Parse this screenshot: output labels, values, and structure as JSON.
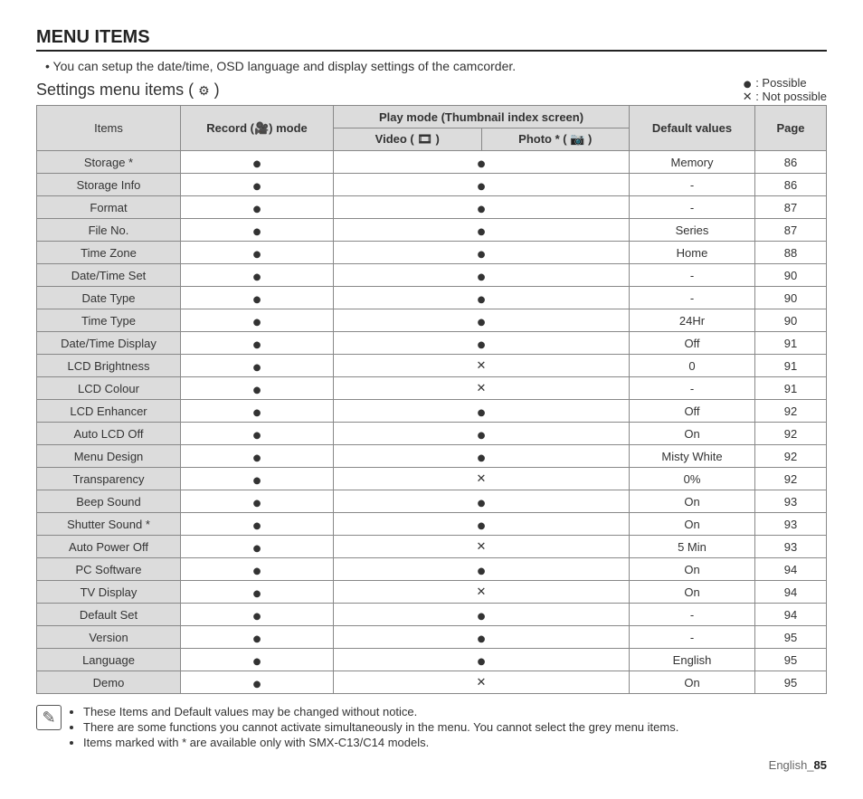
{
  "title": "MENU ITEMS",
  "intro_bullet": "•",
  "intro_text": "You can setup the date/time, OSD language and display settings of the camcorder.",
  "subtitle_prefix": "Settings menu items ( ",
  "subtitle_suffix": " )",
  "legend": {
    "possible_symbol": "●",
    "possible_text": " : Possible",
    "notpossible_symbol": "✕",
    "notpossible_text": " : Not possible"
  },
  "headers": {
    "items": "Items",
    "record": "Record (🎥) mode",
    "playmode": "Play mode (Thumbnail index screen)",
    "video": "Video ( 🎞 )",
    "photo": "Photo * ( 📷 )",
    "default": "Default values",
    "page": "Page"
  },
  "rows": [
    {
      "item": "Storage *",
      "rec": "●",
      "vid": "●",
      "pho": "",
      "def": "Memory",
      "page": "86"
    },
    {
      "item": "Storage Info",
      "rec": "●",
      "vid": "●",
      "pho": "",
      "def": "-",
      "page": "86"
    },
    {
      "item": "Format",
      "rec": "●",
      "vid": "●",
      "pho": "",
      "def": "-",
      "page": "87"
    },
    {
      "item": "File No.",
      "rec": "●",
      "vid": "●",
      "pho": "",
      "def": "Series",
      "page": "87"
    },
    {
      "item": "Time Zone",
      "rec": "●",
      "vid": "●",
      "pho": "",
      "def": "Home",
      "page": "88"
    },
    {
      "item": "Date/Time Set",
      "rec": "●",
      "vid": "●",
      "pho": "",
      "def": "-",
      "page": "90"
    },
    {
      "item": "Date Type",
      "rec": "●",
      "vid": "●",
      "pho": "",
      "def": "-",
      "page": "90"
    },
    {
      "item": "Time Type",
      "rec": "●",
      "vid": "●",
      "pho": "",
      "def": "24Hr",
      "page": "90"
    },
    {
      "item": "Date/Time Display",
      "rec": "●",
      "vid": "●",
      "pho": "",
      "def": "Off",
      "page": "91"
    },
    {
      "item": "LCD Brightness",
      "rec": "●",
      "vid": "✕",
      "pho": "",
      "def": "0",
      "page": "91"
    },
    {
      "item": "LCD Colour",
      "rec": "●",
      "vid": "✕",
      "pho": "",
      "def": "-",
      "page": "91"
    },
    {
      "item": "LCD Enhancer",
      "rec": "●",
      "vid": "●",
      "pho": "",
      "def": "Off",
      "page": "92"
    },
    {
      "item": "Auto LCD Off",
      "rec": "●",
      "vid": "●",
      "pho": "",
      "def": "On",
      "page": "92"
    },
    {
      "item": "Menu Design",
      "rec": "●",
      "vid": "●",
      "pho": "",
      "def": "Misty White",
      "page": "92"
    },
    {
      "item": "Transparency",
      "rec": "●",
      "vid": "✕",
      "pho": "",
      "def": "0%",
      "page": "92"
    },
    {
      "item": "Beep Sound",
      "rec": "●",
      "vid": "●",
      "pho": "",
      "def": "On",
      "page": "93"
    },
    {
      "item": "Shutter Sound *",
      "rec": "●",
      "vid": "●",
      "pho": "",
      "def": "On",
      "page": "93"
    },
    {
      "item": "Auto Power Off",
      "rec": "●",
      "vid": "✕",
      "pho": "",
      "def": "5 Min",
      "page": "93"
    },
    {
      "item": "PC Software",
      "rec": "●",
      "vid": "●",
      "pho": "",
      "def": "On",
      "page": "94"
    },
    {
      "item": "TV Display",
      "rec": "●",
      "vid": "✕",
      "pho": "",
      "def": "On",
      "page": "94"
    },
    {
      "item": "Default Set",
      "rec": "●",
      "vid": "●",
      "pho": "",
      "def": "-",
      "page": "94"
    },
    {
      "item": "Version",
      "rec": "●",
      "vid": "●",
      "pho": "",
      "def": "-",
      "page": "95"
    },
    {
      "item": "Language",
      "rec": "●",
      "vid": "●",
      "pho": "",
      "def": "English",
      "page": "95"
    },
    {
      "item": "Demo",
      "rec": "●",
      "vid": "✕",
      "pho": "",
      "def": "On",
      "page": "95"
    }
  ],
  "notes": [
    "These Items and Default values may be changed without notice.",
    "There are some functions you cannot activate simultaneously in the menu. You cannot select the grey menu items.",
    "Items marked with * are available only with SMX-C13/C14 models."
  ],
  "footer_prefix": "English_",
  "footer_page": "85"
}
